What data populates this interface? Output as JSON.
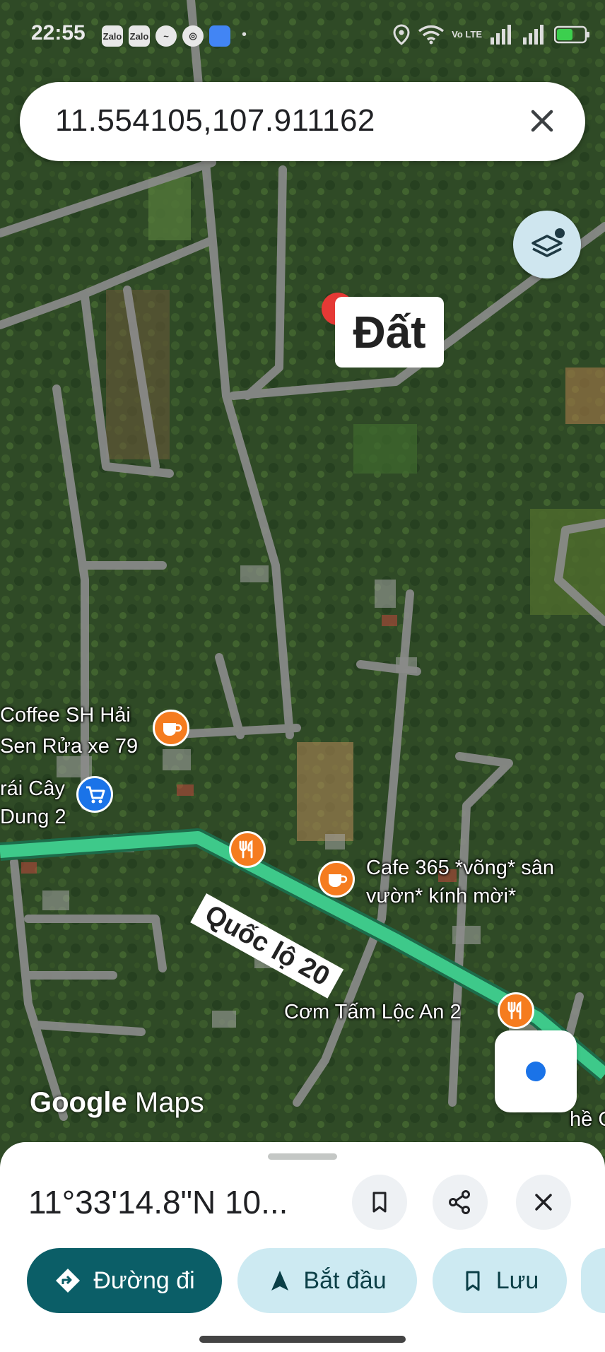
{
  "status_bar": {
    "time": "22:55",
    "app_icons": [
      "Zalo",
      "Zalo"
    ],
    "network_label": "Vo LTE"
  },
  "search": {
    "query": "11.554105,107.911162"
  },
  "marker": {
    "label": "Đất"
  },
  "pois": [
    {
      "name": "Coffee SH Hải",
      "icon": "cafe-icon"
    },
    {
      "name": "Sen Rửa xe 79",
      "icon": "none"
    },
    {
      "name": "rái Cây",
      "icon": "shopping-cart-icon"
    },
    {
      "name": "Dung 2",
      "icon": "none"
    },
    {
      "name": "Cafe 365 *võng* sân",
      "icon": "cafe-icon"
    },
    {
      "name": "vườn* kính mời*",
      "icon": "none"
    },
    {
      "name": "Cơm Tấm Lộc An 2",
      "icon": "restaurant-icon"
    },
    {
      "name": "hề G",
      "icon": "none"
    }
  ],
  "road": {
    "label": "Quốc lộ 20"
  },
  "watermark": {
    "google": "Google",
    "maps": "Maps"
  },
  "bottom_sheet": {
    "coordinates_title": "11°33'14.8\"N 10...",
    "buttons": {
      "directions": "Đường đi",
      "start": "Bắt đầu",
      "save": "Lưu"
    }
  },
  "colors": {
    "primary_button": "#0b5e67",
    "secondary_button": "#cdeaf2",
    "highway": "#3ec98a",
    "poi_orange": "#f57c1f",
    "poi_blue": "#1a73e8"
  }
}
